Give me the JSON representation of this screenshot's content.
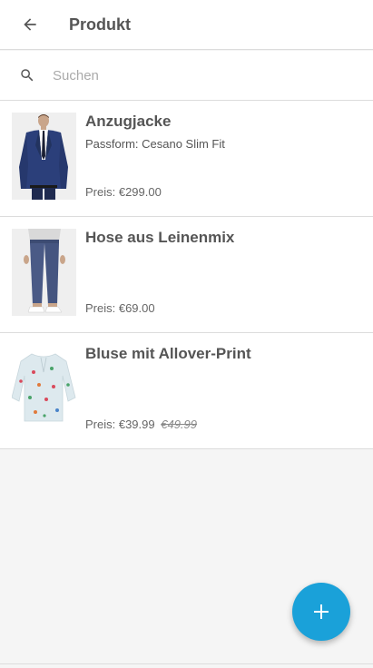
{
  "appbar": {
    "title": "Produkt",
    "back_icon": "arrow-back-icon"
  },
  "search": {
    "placeholder": "Suchen",
    "value": "",
    "icon": "search-icon"
  },
  "products": [
    {
      "title": "Anzugjacke",
      "subtitle": "Passform: Cesano Slim Fit",
      "price": "Preis: €299.00",
      "old_price": "",
      "image": "suit-jacket-photo"
    },
    {
      "title": "Hose aus Leinenmix",
      "subtitle": "",
      "price": "Preis: €69.00",
      "old_price": "",
      "image": "trousers-photo"
    },
    {
      "title": "Bluse mit Allover-Print",
      "subtitle": "",
      "price": "Preis: €39.99",
      "old_price": "€49.99",
      "image": "blouse-photo"
    }
  ],
  "fab": {
    "icon": "plus-icon",
    "color": "#1aa1d9"
  },
  "colors": {
    "accent": "#1aa1d9",
    "background": "#f5f5f5",
    "surface": "#ffffff",
    "divider": "#dcdcdc"
  }
}
